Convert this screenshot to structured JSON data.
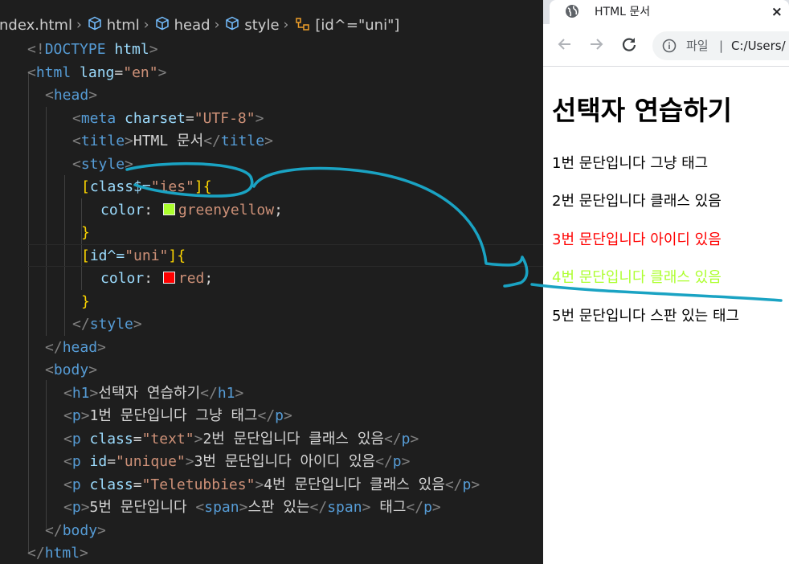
{
  "breadcrumb": {
    "items": [
      "index.html",
      "html",
      "head",
      "style",
      "[id^=\"uni\"]"
    ],
    "icons": [
      "html-file-icon",
      "element-cube-icon",
      "element-cube-icon",
      "element-cube-icon",
      "css-selector-icon"
    ]
  },
  "code": {
    "l1": {
      "open": "<!",
      "kw": "DOCTYPE",
      "name": " html",
      "close": ">"
    },
    "l2": {
      "open": "<",
      "tag": "html",
      "attr": " lang",
      "eq": "=",
      "val": "\"en\"",
      "close": ">"
    },
    "l3": {
      "open": "<",
      "tag": "head",
      "close": ">"
    },
    "l4": {
      "open": "<",
      "tag": "meta",
      "attr": " charset",
      "eq": "=",
      "val": "\"UTF-8\"",
      "close": ">"
    },
    "l5": {
      "open": "<",
      "tag": "title",
      "close": ">",
      "text": "HTML 문서",
      "endopen": "</",
      "endtag": "title",
      "endclose": ">"
    },
    "l6": {
      "open": "<",
      "tag": "style",
      "close": ">"
    },
    "l7": {
      "b1": "[",
      "sel": "class$=",
      "str": "\"ies\"",
      "b2": "]",
      "brace": "{"
    },
    "l8": {
      "prop": "color",
      "colon": ": ",
      "swatch": "#adff2f",
      "val": "greenyellow",
      "semi": ";"
    },
    "l9": {
      "brace": "}"
    },
    "l10": {
      "b1": "[",
      "sel": "id^=",
      "str": "\"uni\"",
      "b2": "]",
      "brace": "{"
    },
    "l11": {
      "prop": "color",
      "colon": ": ",
      "swatch": "#ff0000",
      "val": "red",
      "semi": ";"
    },
    "l12": {
      "brace": "}"
    },
    "l13": {
      "open": "</",
      "tag": "style",
      "close": ">"
    },
    "l14": {
      "open": "</",
      "tag": "head",
      "close": ">"
    },
    "l15": {
      "open": "<",
      "tag": "body",
      "close": ">"
    },
    "l16": {
      "open": "<",
      "tag": "h1",
      "close": ">",
      "text": "선택자 연습하기",
      "endopen": "</",
      "endtag": "h1",
      "endclose": ">"
    },
    "l17": {
      "open": "<",
      "tag": "p",
      "close": ">",
      "text": "1번 문단입니다 그냥 태그",
      "endopen": "</",
      "endtag": "p",
      "endclose": ">"
    },
    "l18": {
      "open": "<",
      "tag": "p",
      "attr": " class",
      "eq": "=",
      "val": "\"text\"",
      "close": ">",
      "text": "2번 문단입니다 클래스 있음",
      "endopen": "</",
      "endtag": "p",
      "endclose": ">"
    },
    "l19": {
      "open": "<",
      "tag": "p",
      "attr": " id",
      "eq": "=",
      "val": "\"unique\"",
      "close": ">",
      "text": "3번 문단입니다 아이디 있음",
      "endopen": "</",
      "endtag": "p",
      "endclose": ">"
    },
    "l20": {
      "open": "<",
      "tag": "p",
      "attr": " class",
      "eq": "=",
      "val": "\"Teletubbies\"",
      "close": ">",
      "text": "4번 문단입니다 클래스 있음",
      "endopen": "</",
      "endtag": "p",
      "endclose": ">"
    },
    "l21": {
      "open": "<",
      "tag": "p",
      "close": ">",
      "text1": "5번 문단입니다 ",
      "sopen": "<",
      "stag": "span",
      "sclose": ">",
      "text2": "스판 있는",
      "seopen": "</",
      "setag": "span",
      "seclose": ">",
      "text3": " 태그",
      "endopen": "</",
      "endtag": "p",
      "endclose": ">"
    },
    "l22": {
      "open": "</",
      "tag": "body",
      "close": ">"
    },
    "l23": {
      "open": "</",
      "tag": "html",
      "close": ">"
    }
  },
  "browser": {
    "tab_title": "HTML 문서",
    "tab_close": "×",
    "tab_icon": "globe-icon",
    "omnibox_label": "파일",
    "omnibox_sep": "|",
    "omnibox_url": "C:/Users/",
    "nav_icons": [
      "back-arrow-icon",
      "forward-arrow-icon",
      "reload-icon",
      "info-icon"
    ]
  },
  "page": {
    "h1": "선택자 연습하기",
    "p1": "1번 문단입니다 그냥 태그",
    "p2": "2번 문단입니다 클래스 있음",
    "p3": "3번 문단입니다 아이디 있음",
    "p4": "4번 문단입니다 클래스 있음",
    "p5": "5번 문단입니다 스판 있는 태그"
  },
  "colors": {
    "editor_bg": "#1e1e1e",
    "tag": "#569cd6",
    "attr": "#9cdcfe",
    "string": "#ce9178",
    "brace": "#ffd700",
    "p3_text": "#ff0000",
    "p4_text": "#adff2f",
    "annotation_pen": "#1aa3c3"
  }
}
